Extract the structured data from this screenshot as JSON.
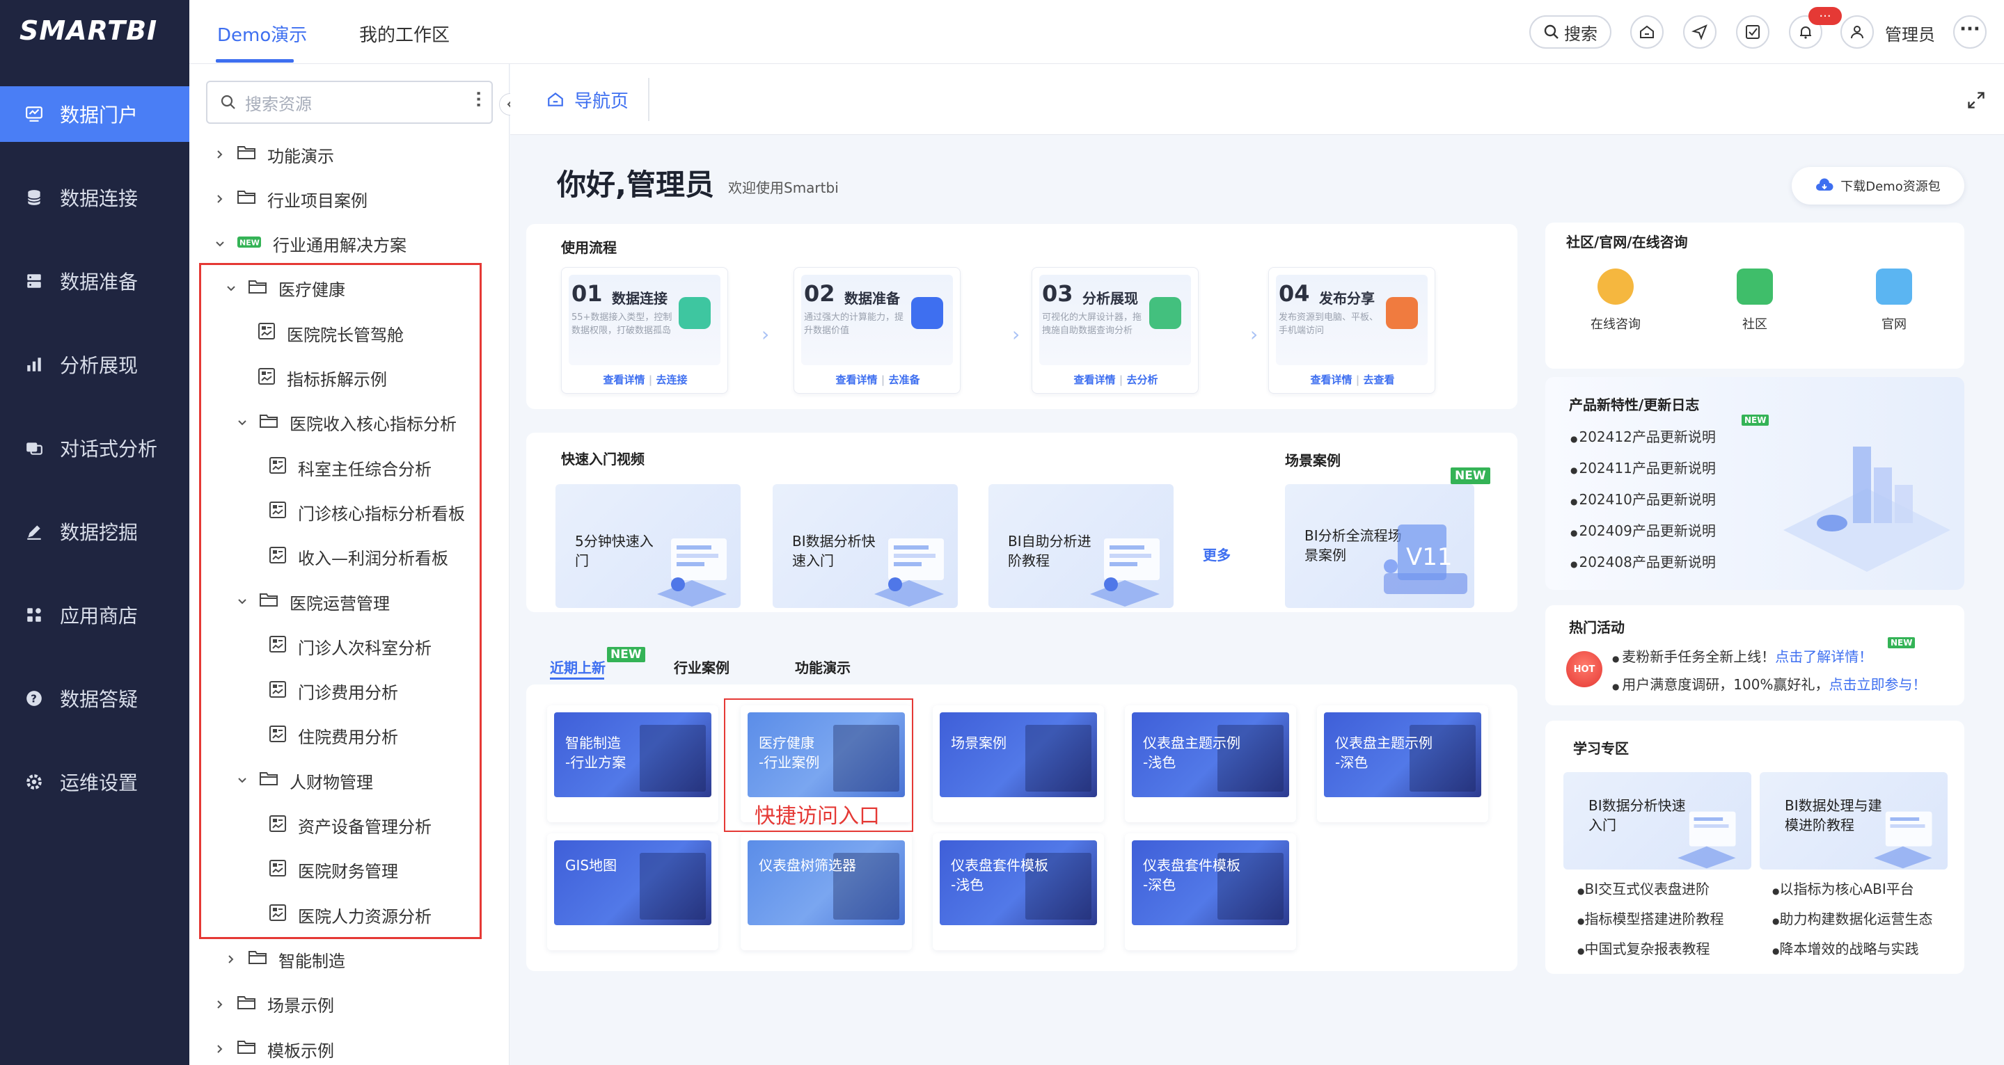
{
  "app": {
    "logo": "SMARTBI"
  },
  "leftnav": [
    {
      "label": "数据门户",
      "icon": "portal-icon",
      "active": true
    },
    {
      "label": "数据连接",
      "icon": "database-icon"
    },
    {
      "label": "数据准备",
      "icon": "server-icon"
    },
    {
      "label": "分析展现",
      "icon": "bar-chart-icon"
    },
    {
      "label": "对话式分析",
      "icon": "chat-icon"
    },
    {
      "label": "数据挖掘",
      "icon": "pencil-icon"
    },
    {
      "label": "应用商店",
      "icon": "apps-icon"
    },
    {
      "label": "数据答疑",
      "icon": "question-icon"
    },
    {
      "label": "运维设置",
      "icon": "gear-icon"
    }
  ],
  "topbar": {
    "tabs": [
      "Demo演示",
      "我的工作区"
    ],
    "search_label": "搜索",
    "notif_badge": "···",
    "user": "管理员"
  },
  "tree": {
    "search_placeholder": "搜索资源",
    "items": [
      {
        "label": "功能演示",
        "type": "folder",
        "expanded": false
      },
      {
        "label": "行业项目案例",
        "type": "folder",
        "expanded": false
      },
      {
        "label": "行业通用解决方案",
        "type": "new",
        "expanded": true
      },
      {
        "label": "医疗健康",
        "type": "folder",
        "expanded": true
      },
      {
        "label": "医院院长管驾舱",
        "type": "doc"
      },
      {
        "label": "指标拆解示例",
        "type": "doc"
      },
      {
        "label": "医院收入核心指标分析",
        "type": "folder",
        "expanded": true
      },
      {
        "label": "科室主任综合分析",
        "type": "doc"
      },
      {
        "label": "门诊核心指标分析看板",
        "type": "doc"
      },
      {
        "label": "收入—利润分析看板",
        "type": "doc"
      },
      {
        "label": "医院运营管理",
        "type": "folder",
        "expanded": true
      },
      {
        "label": "门诊人次科室分析",
        "type": "doc"
      },
      {
        "label": "门诊费用分析",
        "type": "doc"
      },
      {
        "label": "住院费用分析",
        "type": "doc"
      },
      {
        "label": "人财物管理",
        "type": "folder",
        "expanded": true
      },
      {
        "label": "资产设备管理分析",
        "type": "doc"
      },
      {
        "label": "医院财务管理",
        "type": "doc"
      },
      {
        "label": "医院人力资源分析",
        "type": "doc"
      },
      {
        "label": "智能制造",
        "type": "folder",
        "expanded": false
      },
      {
        "label": "场景示例",
        "type": "folder",
        "expanded": false
      },
      {
        "label": "模板示例",
        "type": "folder",
        "expanded": false
      }
    ]
  },
  "page_tab": {
    "label": "导航页"
  },
  "greeting": {
    "title": "你好,管理员",
    "sub": "欢迎使用Smartbi",
    "download_btn": "下载Demo资源包"
  },
  "flow": {
    "title": "使用流程",
    "steps": [
      {
        "num": "01",
        "name": "数据连接",
        "desc": "55+数据接入类型，控制数据权限，打破数据孤岛",
        "link1": "查看详情",
        "link2": "去连接",
        "color": "#3ec6a0"
      },
      {
        "num": "02",
        "name": "数据准备",
        "desc": "通过强大的计算能力，提升数据价值",
        "link1": "查看详情",
        "link2": "去准备",
        "color": "#3e6ff0"
      },
      {
        "num": "03",
        "name": "分析展现",
        "desc": "可视化的大屏设计器，拖拽施自助数据查询分析",
        "link1": "查看详情",
        "link2": "去分析",
        "color": "#43c07e"
      },
      {
        "num": "04",
        "name": "发布分享",
        "desc": "发布资源到电脑、平板、手机端访问",
        "link1": "查看详情",
        "link2": "去查看",
        "color": "#f07b3f"
      }
    ],
    "arrow": "›"
  },
  "videos": {
    "title": "快速入门视频",
    "items": [
      "5分钟快速入门",
      "BI数据分析快速入门",
      "BI自助分析进阶教程"
    ],
    "more": "更多"
  },
  "scene": {
    "title": "场景案例",
    "card": "BI分析全流程场景案例",
    "new_badge": "NEW"
  },
  "subtabs": {
    "items": [
      "近期上新",
      "行业案例",
      "功能演示"
    ],
    "new_badge": "NEW"
  },
  "thumbs": [
    {
      "title1": "智能制造",
      "title2": "-行业方案"
    },
    {
      "title1": "医疗健康",
      "title2": "-行业案例"
    },
    {
      "title1": "场景案例",
      "title2": ""
    },
    {
      "title1": "仪表盘主题示例",
      "title2": "-浅色"
    },
    {
      "title1": "仪表盘主题示例",
      "title2": "-深色"
    },
    {
      "title1": "GIS地图",
      "title2": ""
    },
    {
      "title1": "仪表盘树筛选器",
      "title2": ""
    },
    {
      "title1": "仪表盘套件模板",
      "title2": "-浅色"
    },
    {
      "title1": "仪表盘套件模板",
      "title2": "-深色"
    }
  ],
  "annotation": {
    "text": "快捷访问入口"
  },
  "community": {
    "title": "社区/官网/在线咨询",
    "items": [
      {
        "label": "在线咨询",
        "icon": "phone-icon",
        "color": "#f5b73f"
      },
      {
        "label": "社区",
        "icon": "community-icon",
        "color": "#3fbe6a"
      },
      {
        "label": "官网",
        "icon": "website-icon",
        "color": "#5bb5f2"
      }
    ]
  },
  "changelog": {
    "title": "产品新特性/更新日志",
    "new_badge": "NEW",
    "items": [
      "202412产品更新说明",
      "202411产品更新说明",
      "202410产品更新说明",
      "202409产品更新说明",
      "202408产品更新说明"
    ]
  },
  "events": {
    "title": "热门活动",
    "hot": "HOT",
    "new_badge": "NEW",
    "items": [
      {
        "text": "麦粉新手任务全新上线！",
        "link": "点击了解详情！"
      },
      {
        "text": "用户满意度调研，100%赢好礼，",
        "link": "点击立即参与！"
      }
    ]
  },
  "learn": {
    "title": "学习专区",
    "cards": [
      "BI数据分析快速入门",
      "BI数据处理与建模进阶教程"
    ],
    "col1": [
      "BI交互式仪表盘进阶",
      "指标模型搭建进阶教程",
      "中国式复杂报表教程"
    ],
    "col2": [
      "以指标为核心ABI平台",
      "助力构建数据化运营生态",
      "降本增效的战略与实践"
    ]
  }
}
